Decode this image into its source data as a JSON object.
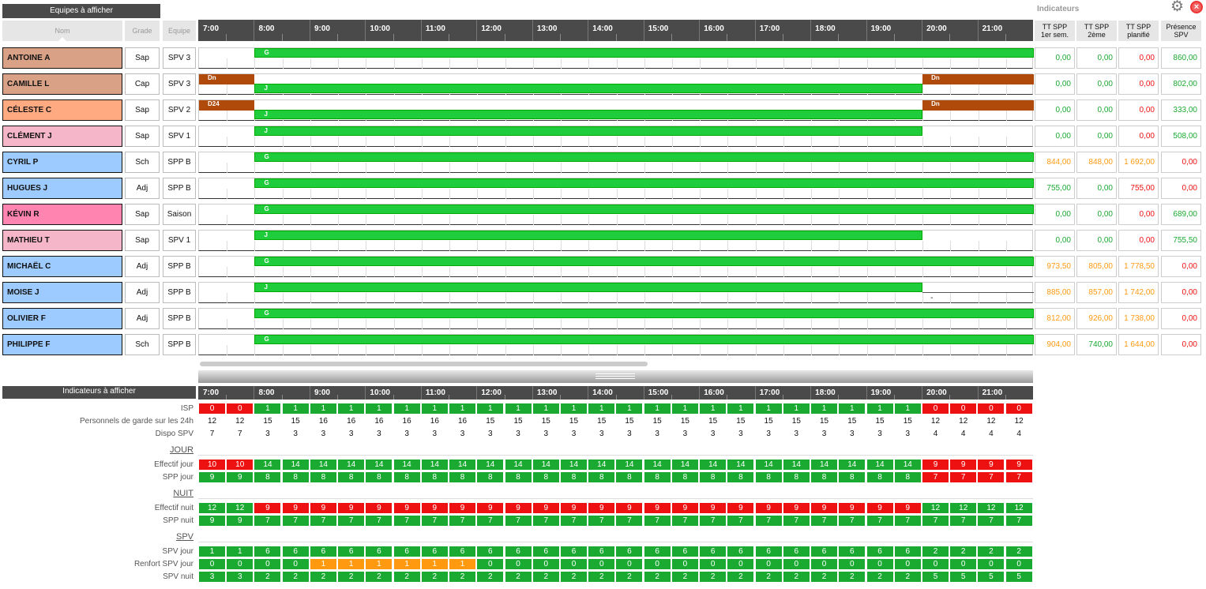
{
  "header": {
    "teams_label": "Equipes à afficher",
    "indicators_title": "Indicateurs",
    "indicators_label": "Indicateurs à afficher"
  },
  "columns": {
    "nom": "Nom",
    "grade": "Grade",
    "equipe": "Equipe"
  },
  "indicator_headers": [
    "TT SPP\n1er sem.",
    "TT SPP\n2ème",
    "TT SPP\nplanifié",
    "Présence\nSPV"
  ],
  "hours": [
    "7:00",
    "8:00",
    "9:00",
    "10:00",
    "11:00",
    "12:00",
    "13:00",
    "14:00",
    "15:00",
    "16:00",
    "17:00",
    "18:00",
    "19:00",
    "20:00",
    "21:00"
  ],
  "colors": {
    "salmon": "#d9a286",
    "orange": "#ffaa80",
    "pink": "#f4b6c8",
    "blue": "#9dcbff",
    "hotpink": "#ff85b0",
    "green": "#1aaa32",
    "red": "#ee1111",
    "ind_orange": "#ff9a10"
  },
  "people": [
    {
      "name": "ANTOINE A",
      "grade": "Sap",
      "team": "SPV 3",
      "color": "salmon",
      "bars": [
        {
          "label": "G",
          "start": 1,
          "end": 15,
          "row": 0,
          "type": "green"
        }
      ],
      "ind": [
        {
          "v": "0,00",
          "c": "g"
        },
        {
          "v": "0,00",
          "c": "g"
        },
        {
          "v": "0,00",
          "c": "r"
        },
        {
          "v": "860,00",
          "c": "g"
        }
      ]
    },
    {
      "name": "CAMILLE L",
      "grade": "Cap",
      "team": "SPV 3",
      "color": "salmon",
      "bars": [
        {
          "label": "Dn",
          "start": 0,
          "end": 1,
          "row": 0,
          "type": "brown"
        },
        {
          "label": "Dn",
          "start": 13,
          "end": 15,
          "row": 0,
          "type": "brown"
        },
        {
          "label": "J",
          "start": 1,
          "end": 13,
          "row": 1,
          "type": "green"
        }
      ],
      "ind": [
        {
          "v": "0,00",
          "c": "g"
        },
        {
          "v": "0,00",
          "c": "g"
        },
        {
          "v": "0,00",
          "c": "r"
        },
        {
          "v": "802,00",
          "c": "g"
        }
      ]
    },
    {
      "name": "CÉLESTE C",
      "grade": "Sap",
      "team": "SPV 2",
      "color": "orange",
      "bars": [
        {
          "label": "D24",
          "start": 0,
          "end": 1,
          "row": 0,
          "type": "brown"
        },
        {
          "label": "Dn",
          "start": 13,
          "end": 15,
          "row": 0,
          "type": "brown"
        },
        {
          "label": "J",
          "start": 1,
          "end": 13,
          "row": 1,
          "type": "green"
        }
      ],
      "ind": [
        {
          "v": "0,00",
          "c": "g"
        },
        {
          "v": "0,00",
          "c": "g"
        },
        {
          "v": "0,00",
          "c": "r"
        },
        {
          "v": "333,00",
          "c": "g"
        }
      ]
    },
    {
      "name": "CLÉMENT J",
      "grade": "Sap",
      "team": "SPV 1",
      "color": "pink",
      "bars": [
        {
          "label": "J",
          "start": 1,
          "end": 13,
          "row": 0,
          "type": "green"
        }
      ],
      "ind": [
        {
          "v": "0,00",
          "c": "g"
        },
        {
          "v": "0,00",
          "c": "g"
        },
        {
          "v": "0,00",
          "c": "r"
        },
        {
          "v": "508,00",
          "c": "g"
        }
      ]
    },
    {
      "name": "CYRIL P",
      "grade": "Sch",
      "team": "SPP B",
      "color": "blue",
      "bars": [
        {
          "label": "G",
          "start": 1,
          "end": 15,
          "row": 0,
          "type": "green"
        }
      ],
      "ind": [
        {
          "v": "844,00",
          "c": "o"
        },
        {
          "v": "848,00",
          "c": "o"
        },
        {
          "v": "1 692,00",
          "c": "o"
        },
        {
          "v": "0,00",
          "c": "r"
        }
      ]
    },
    {
      "name": "HUGUES J",
      "grade": "Adj",
      "team": "SPP B",
      "color": "blue",
      "bars": [
        {
          "label": "G",
          "start": 1,
          "end": 15,
          "row": 0,
          "type": "green"
        }
      ],
      "ind": [
        {
          "v": "755,00",
          "c": "g"
        },
        {
          "v": "0,00",
          "c": "g"
        },
        {
          "v": "755,00",
          "c": "r"
        },
        {
          "v": "0,00",
          "c": "r"
        }
      ]
    },
    {
      "name": "KÉVIN R",
      "grade": "Sap",
      "team": "Saison",
      "color": "hotpink",
      "bars": [
        {
          "label": "G",
          "start": 1,
          "end": 15,
          "row": 0,
          "type": "green"
        }
      ],
      "ind": [
        {
          "v": "0,00",
          "c": "g"
        },
        {
          "v": "0,00",
          "c": "g"
        },
        {
          "v": "0,00",
          "c": "r"
        },
        {
          "v": "689,00",
          "c": "g"
        }
      ]
    },
    {
      "name": "MATHIEU T",
      "grade": "Sap",
      "team": "SPV 1",
      "color": "pink",
      "bars": [
        {
          "label": "J",
          "start": 1,
          "end": 13,
          "row": 0,
          "type": "green"
        }
      ],
      "ind": [
        {
          "v": "0,00",
          "c": "g"
        },
        {
          "v": "0,00",
          "c": "g"
        },
        {
          "v": "0,00",
          "c": "r"
        },
        {
          "v": "755,50",
          "c": "g"
        }
      ]
    },
    {
      "name": "MICHAËL C",
      "grade": "Adj",
      "team": "SPP B",
      "color": "blue",
      "bars": [
        {
          "label": "G",
          "start": 1,
          "end": 15,
          "row": 0,
          "type": "green"
        }
      ],
      "ind": [
        {
          "v": "973,50",
          "c": "o"
        },
        {
          "v": "805,00",
          "c": "o"
        },
        {
          "v": "1 778,50",
          "c": "o"
        },
        {
          "v": "0,00",
          "c": "r"
        }
      ]
    },
    {
      "name": "MOISE J",
      "grade": "Adj",
      "team": "SPP B",
      "color": "blue",
      "bars": [
        {
          "label": "J",
          "start": 1,
          "end": 13,
          "row": 0,
          "type": "green"
        }
      ],
      "dash": "-",
      "ind": [
        {
          "v": "885,00",
          "c": "o"
        },
        {
          "v": "857,00",
          "c": "o"
        },
        {
          "v": "1 742,00",
          "c": "o"
        },
        {
          "v": "0,00",
          "c": "r"
        }
      ]
    },
    {
      "name": "OLIVIER F",
      "grade": "Adj",
      "team": "SPP B",
      "color": "blue",
      "bars": [
        {
          "label": "G",
          "start": 1,
          "end": 15,
          "row": 0,
          "type": "green"
        }
      ],
      "ind": [
        {
          "v": "812,00",
          "c": "o"
        },
        {
          "v": "926,00",
          "c": "o"
        },
        {
          "v": "1 738,00",
          "c": "o"
        },
        {
          "v": "0,00",
          "c": "r"
        }
      ]
    },
    {
      "name": "PHILIPPE F",
      "grade": "Sch",
      "team": "SPP B",
      "color": "blue",
      "bars": [
        {
          "label": "G",
          "start": 1,
          "end": 15,
          "row": 0,
          "type": "green"
        }
      ],
      "ind": [
        {
          "v": "904,00",
          "c": "o"
        },
        {
          "v": "740,00",
          "c": "g"
        },
        {
          "v": "1 644,00",
          "c": "o"
        },
        {
          "v": "0,00",
          "c": "r"
        }
      ]
    }
  ],
  "stats": [
    {
      "kind": "cells",
      "label": "ISP",
      "values": [
        0,
        0,
        1,
        1,
        1,
        1,
        1,
        1,
        1,
        1,
        1,
        1,
        1,
        1,
        1,
        1,
        1,
        1,
        1,
        1,
        1,
        1,
        1,
        1,
        1,
        1,
        0,
        0,
        0,
        0
      ],
      "colors": "rrggggggggggggggggggggggggrrrr"
    },
    {
      "kind": "plain",
      "label": "Personnels de garde sur les 24h",
      "values": [
        12,
        12,
        15,
        15,
        16,
        16,
        16,
        16,
        16,
        16,
        15,
        15,
        15,
        15,
        15,
        15,
        15,
        15,
        15,
        15,
        15,
        15,
        15,
        15,
        15,
        15,
        12,
        12,
        12,
        12
      ]
    },
    {
      "kind": "plain",
      "label": "Dispo SPV",
      "values": [
        7,
        7,
        3,
        3,
        3,
        3,
        3,
        3,
        3,
        3,
        3,
        3,
        3,
        3,
        3,
        3,
        3,
        3,
        3,
        3,
        3,
        3,
        3,
        3,
        3,
        3,
        4,
        4,
        4,
        4
      ]
    },
    {
      "kind": "section",
      "label": "JOUR"
    },
    {
      "kind": "cells",
      "label": "Effectif jour",
      "values": [
        10,
        10,
        14,
        14,
        14,
        14,
        14,
        14,
        14,
        14,
        14,
        14,
        14,
        14,
        14,
        14,
        14,
        14,
        14,
        14,
        14,
        14,
        14,
        14,
        14,
        14,
        9,
        9,
        9,
        9
      ],
      "colors": "rrggggggggggggggggggggggggrrrr"
    },
    {
      "kind": "cells",
      "label": "SPP jour",
      "values": [
        9,
        9,
        8,
        8,
        8,
        8,
        8,
        8,
        8,
        8,
        8,
        8,
        8,
        8,
        8,
        8,
        8,
        8,
        8,
        8,
        8,
        8,
        8,
        8,
        8,
        8,
        7,
        7,
        7,
        7
      ],
      "colors": "ggggggggggggggggggggggggggrrrr"
    },
    {
      "kind": "section",
      "label": "NUIT"
    },
    {
      "kind": "cells",
      "label": "Effectif nuit",
      "values": [
        12,
        12,
        9,
        9,
        9,
        9,
        9,
        9,
        9,
        9,
        9,
        9,
        9,
        9,
        9,
        9,
        9,
        9,
        9,
        9,
        9,
        9,
        9,
        9,
        9,
        9,
        12,
        12,
        12,
        12
      ],
      "colors": "ggrrrrrrrrrrrrrrrrrrrrrrrrgggg"
    },
    {
      "kind": "cells",
      "label": "SPP nuit",
      "values": [
        9,
        9,
        7,
        7,
        7,
        7,
        7,
        7,
        7,
        7,
        7,
        7,
        7,
        7,
        7,
        7,
        7,
        7,
        7,
        7,
        7,
        7,
        7,
        7,
        7,
        7,
        7,
        7,
        7,
        7
      ],
      "colors": "gggggggggggggggggggggggggggggg"
    },
    {
      "kind": "section",
      "label": "SPV"
    },
    {
      "kind": "cells",
      "label": "SPV jour",
      "values": [
        1,
        1,
        6,
        6,
        6,
        6,
        6,
        6,
        6,
        6,
        6,
        6,
        6,
        6,
        6,
        6,
        6,
        6,
        6,
        6,
        6,
        6,
        6,
        6,
        6,
        6,
        2,
        2,
        2,
        2
      ],
      "colors": "gggggggggggggggggggggggggggggg"
    },
    {
      "kind": "cells",
      "label": "Renfort SPV jour",
      "values": [
        0,
        0,
        0,
        0,
        1,
        1,
        1,
        1,
        1,
        1,
        0,
        0,
        0,
        0,
        0,
        0,
        0,
        0,
        0,
        0,
        0,
        0,
        0,
        0,
        0,
        0,
        0,
        0,
        0,
        0
      ],
      "colors": "ggggooooooggggggggggggggggggggg"
    },
    {
      "kind": "cells",
      "label": "SPV nuit",
      "values": [
        3,
        3,
        2,
        2,
        2,
        2,
        2,
        2,
        2,
        2,
        2,
        2,
        2,
        2,
        2,
        2,
        2,
        2,
        2,
        2,
        2,
        2,
        2,
        2,
        2,
        2,
        5,
        5,
        5,
        5
      ],
      "colors": "gggggggggggggggggggggggggggggg"
    }
  ]
}
